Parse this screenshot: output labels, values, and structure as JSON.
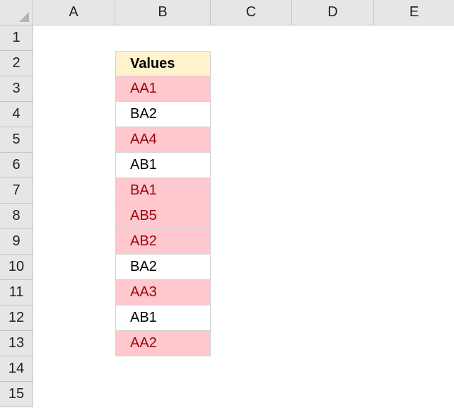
{
  "columns": [
    "A",
    "B",
    "C",
    "D",
    "E"
  ],
  "rows": [
    "1",
    "2",
    "3",
    "4",
    "5",
    "6",
    "7",
    "8",
    "9",
    "10",
    "11",
    "12",
    "13",
    "14",
    "15"
  ],
  "table": {
    "header": "Values",
    "cells": [
      {
        "value": "AA1",
        "highlighted": true
      },
      {
        "value": "BA2",
        "highlighted": false
      },
      {
        "value": "AA4",
        "highlighted": true
      },
      {
        "value": "AB1",
        "highlighted": false
      },
      {
        "value": "BA1",
        "highlighted": true
      },
      {
        "value": "AB5",
        "highlighted": true
      },
      {
        "value": "AB2",
        "highlighted": true
      },
      {
        "value": "BA2",
        "highlighted": false
      },
      {
        "value": "AA3",
        "highlighted": true
      },
      {
        "value": "AB1",
        "highlighted": false
      },
      {
        "value": "AA2",
        "highlighted": true
      }
    ]
  },
  "colors": {
    "header_fill": "#fff2cc",
    "highlight_fill": "#ffc7ce",
    "highlight_text": "#9c0006",
    "grid_header": "#e6e6e6"
  }
}
